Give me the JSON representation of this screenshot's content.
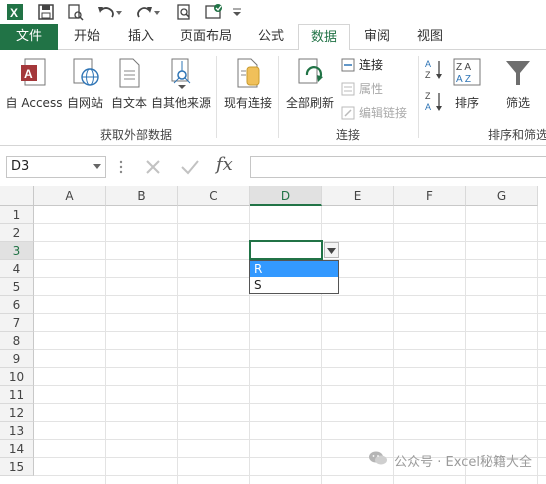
{
  "tabs": [
    {
      "label": "文件"
    },
    {
      "label": "开始"
    },
    {
      "label": "插入"
    },
    {
      "label": "页面布局"
    },
    {
      "label": "公式"
    },
    {
      "label": "数据"
    },
    {
      "label": "审阅"
    },
    {
      "label": "视图"
    }
  ],
  "ribbon": {
    "get_external": {
      "access_label": "自 Access",
      "web_label": "自网站",
      "text_label": "自文本",
      "other_label": "自其他来源",
      "group_label": "获取外部数据"
    },
    "existing_label": "现有连接",
    "connections": {
      "refresh_label": "全部刷新",
      "connect_label": "连接",
      "props_label": "属性",
      "edit_links_label": "编辑链接",
      "group_label": "连接"
    },
    "sort_filter": {
      "sort_label": "排序",
      "filter_label": "筛选",
      "group_label": "排序和筛选"
    }
  },
  "formula_bar": {
    "name_box": "D3",
    "fx_label": "fx"
  },
  "grid": {
    "columns": [
      "A",
      "B",
      "C",
      "D",
      "E",
      "F",
      "G"
    ],
    "rows": [
      "1",
      "2",
      "3",
      "4",
      "5",
      "6",
      "7",
      "8",
      "9",
      "10",
      "11",
      "12",
      "13",
      "14",
      "15"
    ]
  },
  "dropdown": {
    "options": [
      "R",
      "S"
    ],
    "highlighted": "R"
  },
  "watermark": "公众号 · Excel秘籍大全",
  "colors": {
    "accent": "#217346",
    "highlight": "#3399ff"
  }
}
